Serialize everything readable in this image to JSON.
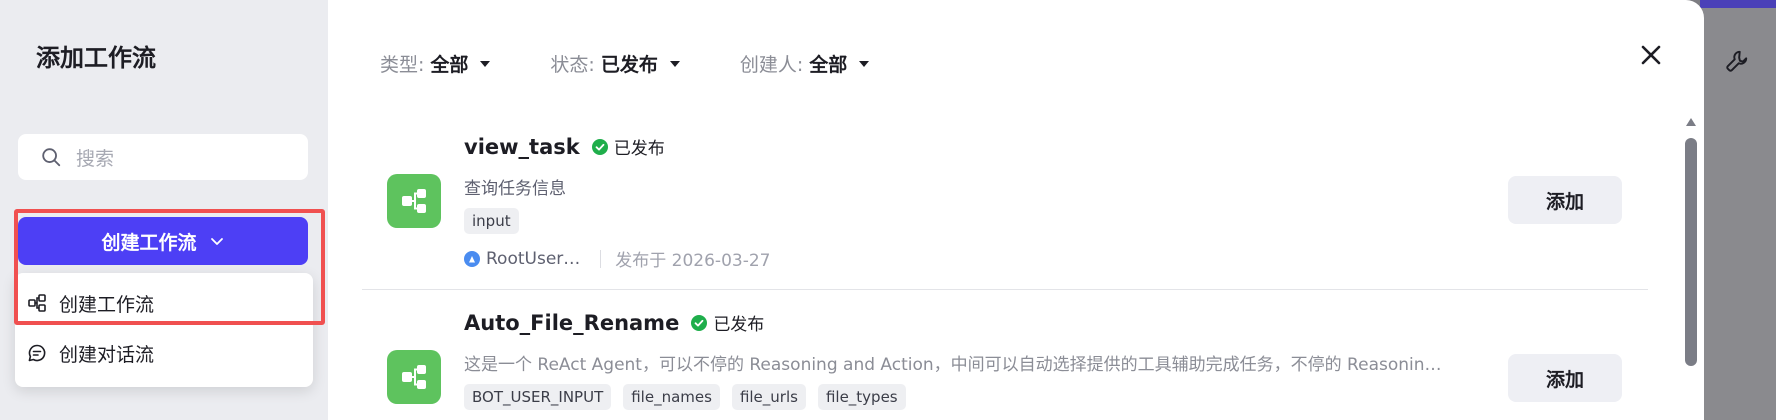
{
  "sidebar": {
    "title": "添加工作流",
    "search_placeholder": "搜索",
    "create_button": "创建工作流",
    "menu": [
      {
        "label": "创建工作流",
        "icon": "workflow-icon"
      },
      {
        "label": "创建对话流",
        "icon": "chat-flow-icon"
      }
    ]
  },
  "filters": [
    {
      "label": "类型:",
      "value": "全部"
    },
    {
      "label": "状态:",
      "value": "已发布"
    },
    {
      "label": "创建人:",
      "value": "全部"
    }
  ],
  "workflows": [
    {
      "name": "view_task",
      "status": "已发布",
      "description": "查询任务信息",
      "tags": [
        "input"
      ],
      "author": "RootUser…",
      "published": "发布于 2026-03-27",
      "add_label": "添加"
    },
    {
      "name": "Auto_File_Rename",
      "status": "已发布",
      "description": "这是一个 ReAct Agent，可以不停的 Reasoning and Action，中间可以自动选择提供的工具辅助完成任务，不停的 Reasonin…",
      "tags": [
        "BOT_USER_INPUT",
        "file_names",
        "file_urls",
        "file_types"
      ],
      "add_label": "添加"
    }
  ],
  "colors": {
    "accent": "#4d3ff5",
    "workflow_icon_bg": "#5ec35e",
    "published_green": "#1fae4b",
    "highlight": "#f05050"
  }
}
